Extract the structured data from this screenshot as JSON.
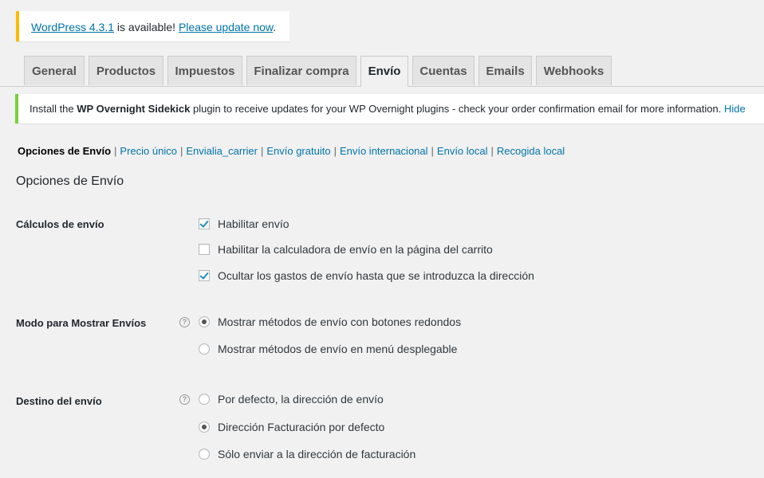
{
  "update_nag": {
    "version_link": "WordPress 4.3.1",
    "middle_text": " is available! ",
    "update_link": "Please update now",
    "end_text": "."
  },
  "tabs": [
    {
      "label": "General",
      "active": false
    },
    {
      "label": "Productos",
      "active": false
    },
    {
      "label": "Impuestos",
      "active": false
    },
    {
      "label": "Finalizar compra",
      "active": false
    },
    {
      "label": "Envío",
      "active": true
    },
    {
      "label": "Cuentas",
      "active": false
    },
    {
      "label": "Emails",
      "active": false
    },
    {
      "label": "Webhooks",
      "active": false
    }
  ],
  "notice": {
    "prefix": "Install the ",
    "plugin_name": "WP Overnight Sidekick",
    "suffix": " plugin to receive updates for your WP Overnight plugins - check your order confirmation email for more information. ",
    "hide_link": "Hide"
  },
  "subnav": {
    "current": "Opciones de Envío",
    "separator": "|",
    "links": [
      "Precio único",
      "Envialia_carrier",
      "Envío gratuito",
      "Envío internacional",
      "Envío local",
      "Recogida local"
    ]
  },
  "section_title": "Opciones de Envío",
  "settings": {
    "calculos": {
      "label": "Cálculos de envío",
      "options": [
        {
          "text": "Habilitar envío",
          "checked": true
        },
        {
          "text": "Habilitar la calculadora de envío en la página del carrito",
          "checked": false
        },
        {
          "text": "Ocultar los gastos de envío hasta que se introduzca la dirección",
          "checked": true
        }
      ]
    },
    "modo": {
      "label": "Modo para Mostrar Envíos",
      "help": "?",
      "options": [
        {
          "text": "Mostrar métodos de envío con botones redondos",
          "checked": true
        },
        {
          "text": "Mostrar métodos de envío en menú desplegable",
          "checked": false
        }
      ]
    },
    "destino": {
      "label": "Destino del envío",
      "help": "?",
      "options": [
        {
          "text": "Por defecto, la dirección de envío",
          "checked": false
        },
        {
          "text": "Dirección Facturación por defecto",
          "checked": true
        },
        {
          "text": "Sólo enviar a la dirección de facturación",
          "checked": false
        }
      ]
    }
  },
  "colors": {
    "link": "#0073aa",
    "nag_border": "#ffba00",
    "notice_border": "#7ad03a",
    "checkmark": "#1e8cbe"
  }
}
